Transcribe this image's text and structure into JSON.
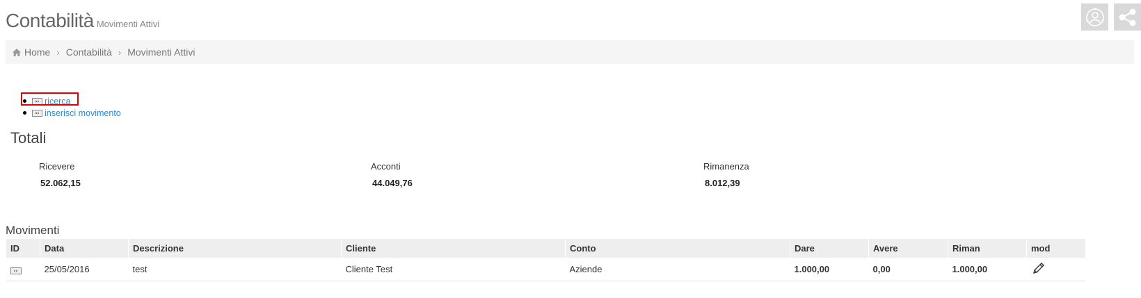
{
  "header": {
    "title": "Contabilità",
    "subtitle": "Movimenti Attivi",
    "icons": [
      "user-circle-icon",
      "share-icon"
    ]
  },
  "breadcrumb": {
    "items": [
      "Home",
      "Contabilità",
      "Movimenti Attivi"
    ]
  },
  "actions": {
    "button_glyph": "››",
    "items": [
      {
        "label": "ricerca",
        "highlighted": true
      },
      {
        "label": "inserisci movimento",
        "highlighted": false
      }
    ]
  },
  "totals": {
    "title": "Totali",
    "ricevere": {
      "label": "Ricevere",
      "value": "52.062,15"
    },
    "acconti": {
      "label": "Acconti",
      "value": "44.049,76"
    },
    "rimanenza": {
      "label": "Rimanenza",
      "value": "8.012,39"
    }
  },
  "movimenti": {
    "title": "Movimenti",
    "columns": [
      "ID",
      "Data",
      "Descrizione",
      "Cliente",
      "Conto",
      "Dare",
      "Avere",
      "Riman",
      "mod"
    ],
    "rows": [
      {
        "id_glyph": "››",
        "data": "25/05/2016",
        "descrizione": "test",
        "cliente": "Cliente Test",
        "conto": "Aziende",
        "dare": "1.000,00",
        "avere": "0,00",
        "riman": "1.000,00",
        "mod_icon": "pencil-icon"
      }
    ]
  },
  "colors": {
    "link": "#2a8dd4",
    "highlight": "#e00000",
    "icon_bg": "#d9d9d9"
  }
}
